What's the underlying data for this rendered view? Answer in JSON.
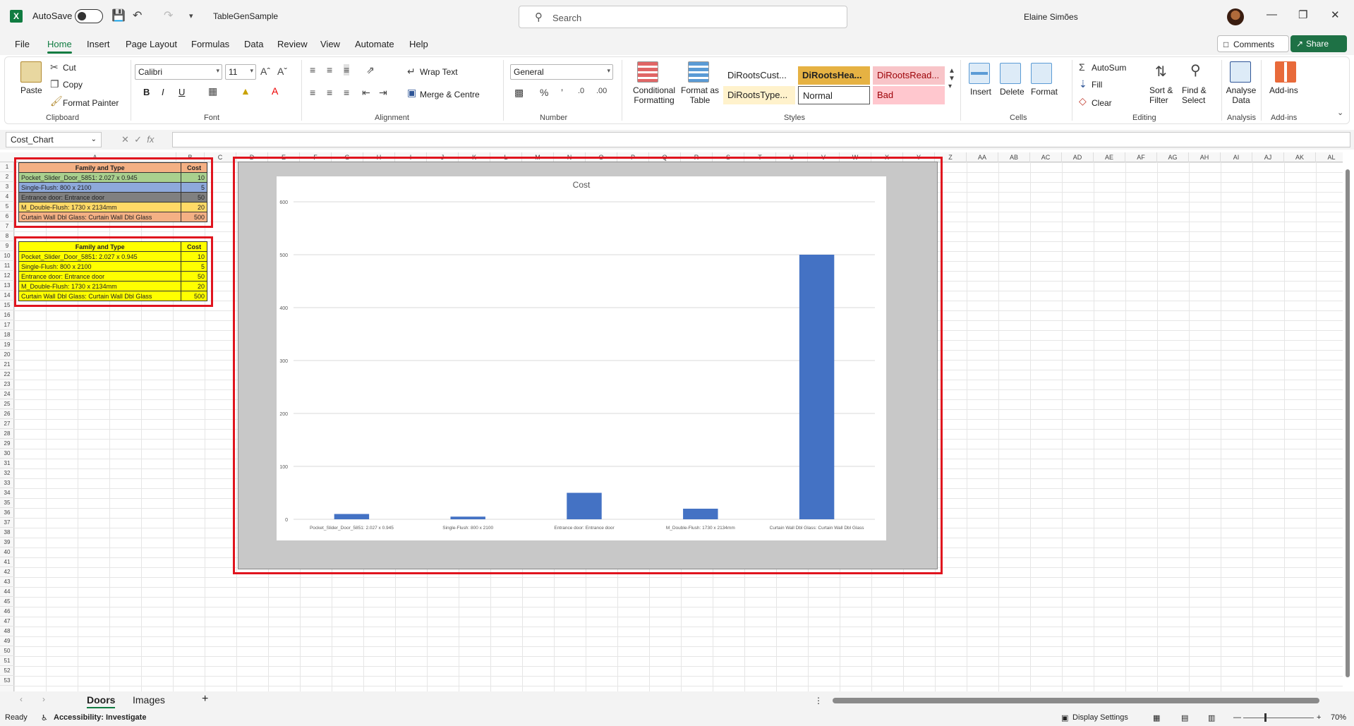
{
  "titlebar": {
    "autosave_label": "AutoSave",
    "doc_title": "TableGenSample",
    "search_placeholder": "Search",
    "user_name": "Elaine Simões"
  },
  "menu": {
    "tabs": [
      "File",
      "Home",
      "Insert",
      "Page Layout",
      "Formulas",
      "Data",
      "Review",
      "View",
      "Automate",
      "Help"
    ],
    "active": "Home",
    "comments": "Comments",
    "share": "Share"
  },
  "ribbon": {
    "clipboard": {
      "paste": "Paste",
      "cut": "Cut",
      "copy": "Copy",
      "format_painter": "Format Painter",
      "label": "Clipboard"
    },
    "font": {
      "name": "Calibri",
      "size": "11",
      "bold": "B",
      "italic": "I",
      "underline": "U",
      "label": "Font"
    },
    "alignment": {
      "wrap_text": "Wrap Text",
      "merge": "Merge & Centre",
      "label": "Alignment"
    },
    "number": {
      "format": "General",
      "label": "Number"
    },
    "styles": {
      "conditional": "Conditional Formatting",
      "format_table": "Format as Table",
      "cells": [
        "DiRootsCust...",
        "DiRootsHea...",
        "DiRootsRead...",
        "DiRootsType...",
        "Normal",
        "Bad"
      ],
      "label": "Styles"
    },
    "cells": {
      "insert": "Insert",
      "delete": "Delete",
      "format": "Format",
      "label": "Cells"
    },
    "editing": {
      "autosum": "AutoSum",
      "fill": "Fill",
      "clear": "Clear",
      "sort": "Sort & Filter",
      "find": "Find & Select",
      "label": "Editing"
    },
    "analysis": {
      "analyse": "Analyse Data",
      "label": "Analysis"
    },
    "addins": {
      "addins": "Add-ins",
      "label": "Add-ins"
    }
  },
  "formula": {
    "name_box": "Cost_Chart",
    "fx": "fx",
    "content": ""
  },
  "columns": [
    "A",
    "B",
    "C",
    "D",
    "E",
    "F",
    "G",
    "H",
    "I",
    "J",
    "K",
    "L",
    "M",
    "N",
    "O",
    "P",
    "Q",
    "R",
    "S",
    "T",
    "U",
    "V",
    "W",
    "X",
    "Y",
    "Z",
    "AA",
    "AB",
    "AC",
    "AD",
    "AE",
    "AF",
    "AG",
    "AH",
    "AI",
    "AJ",
    "AK",
    "AL"
  ],
  "table1": {
    "headers": [
      "Family and Type",
      "Cost"
    ],
    "rows": [
      {
        "name": "Pocket_Slider_Door_5851: 2.027 x 0.945",
        "cost": "10",
        "color": "#a9d08e"
      },
      {
        "name": "Single-Flush: 800 x 2100",
        "cost": "5",
        "color": "#8ea9db"
      },
      {
        "name": "Entrance door: Entrance door",
        "cost": "50",
        "color": "#808080"
      },
      {
        "name": "M_Double-Flush: 1730 x 2134mm",
        "cost": "20",
        "color": "#ffd966"
      },
      {
        "name": "Curtain Wall Dbl Glass: Curtain Wall Dbl Glass",
        "cost": "500",
        "color": "#f4b084"
      }
    ],
    "header_color": "#f4b084"
  },
  "table2": {
    "headers": [
      "Family and Type",
      "Cost"
    ],
    "rows": [
      {
        "name": "Pocket_Slider_Door_5851: 2.027 x 0.945",
        "cost": "10"
      },
      {
        "name": "Single-Flush: 800 x 2100",
        "cost": "5"
      },
      {
        "name": "Entrance door: Entrance door",
        "cost": "50"
      },
      {
        "name": "M_Double-Flush: 1730 x 2134mm",
        "cost": "20"
      },
      {
        "name": "Curtain Wall Dbl Glass: Curtain Wall Dbl Glass",
        "cost": "500"
      }
    ],
    "fill_color": "#ffff00"
  },
  "chart_data": {
    "type": "bar",
    "title": "Cost",
    "categories": [
      "Pocket_Slider_Door_5851: 2.027 x 0.945",
      "Single-Flush: 800 x 2100",
      "Entrance door: Entrance door",
      "M_Double-Flush: 1730 x 2134mm",
      "Curtain Wall Dbl Glass: Curtain Wall Dbl Glass"
    ],
    "values": [
      10,
      5,
      50,
      20,
      500
    ],
    "ylim": [
      0,
      600
    ],
    "yticks": [
      0,
      100,
      200,
      300,
      400,
      500,
      600
    ],
    "grid": true,
    "bar_color": "#4472c4"
  },
  "sheets": {
    "tabs": [
      "Doors",
      "Images"
    ],
    "active": "Doors"
  },
  "status": {
    "ready": "Ready",
    "accessibility": "Accessibility: Investigate",
    "display": "Display Settings",
    "zoom": "70%"
  }
}
